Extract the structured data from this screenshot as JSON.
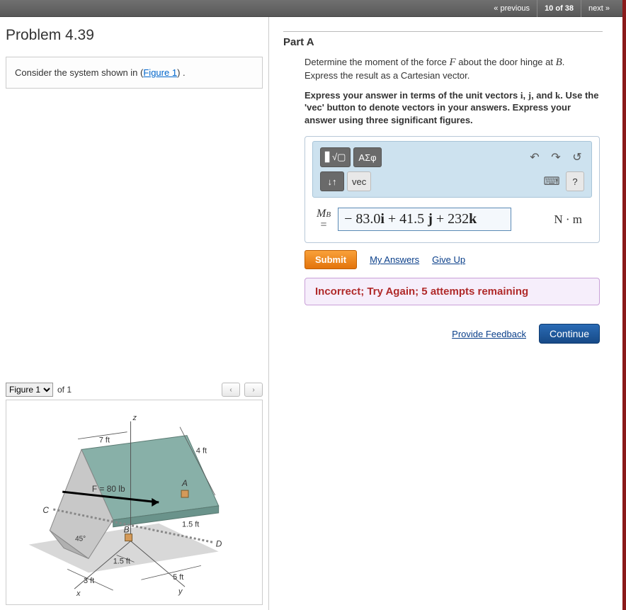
{
  "topbar": {
    "prev": "« previous",
    "counter": "10 of 38",
    "next": "next »"
  },
  "problem": {
    "title": "Problem 4.39",
    "intro_pre": "Consider the system shown in (",
    "figure_link": "Figure 1",
    "intro_post": ") ."
  },
  "figure": {
    "selector_label": "Figure 1",
    "count_label": "of 1",
    "labels": {
      "z": "z",
      "x": "x",
      "y": "y",
      "A": "A",
      "B": "B",
      "C": "C",
      "D": "D",
      "force": "F = 80 lb",
      "d7": "7 ft",
      "d4": "4 ft",
      "d3": "3 ft",
      "d5": "5 ft",
      "d15a": "1.5 ft",
      "d15b": "1.5 ft",
      "ang": "45°"
    }
  },
  "partA": {
    "heading": "Part A",
    "desc_1": "Determine the moment of the force ",
    "desc_F": "F",
    "desc_2": " about the door hinge at ",
    "desc_B": "B",
    "desc_3": ". Express the result as a Cartesian vector.",
    "instr_1": "Express your answer in terms of the unit vectors ",
    "iv": "i",
    "jv": "j",
    "kv": "k",
    "instr_2": ". Use the 'vec' button to denote vectors in your answers. Express your answer using three significant figures.",
    "tools": {
      "template": "▋√▢",
      "greek": "ΑΣφ",
      "updown": "↓↑",
      "vec": "vec",
      "undo": "↶",
      "redo": "↷",
      "reset": "↺",
      "keyboard": "⌨",
      "help": "?"
    },
    "var_label_top": "M",
    "var_label_sub": "B",
    "var_eq": "=",
    "answer_value": "− 83.0i + 41.5 j  + 232k",
    "answer_plain": "− 83.0",
    "answer_i": "i",
    "answer_mid1": " + 41.5 ",
    "answer_j": "j",
    "answer_mid2": "  + 232",
    "answer_k": "k",
    "units": "N · m",
    "submit": "Submit",
    "my_answers": "My Answers",
    "give_up": "Give Up",
    "feedback": "Incorrect; Try Again; 5 attempts remaining",
    "provide_feedback": "Provide Feedback",
    "continue": "Continue"
  }
}
